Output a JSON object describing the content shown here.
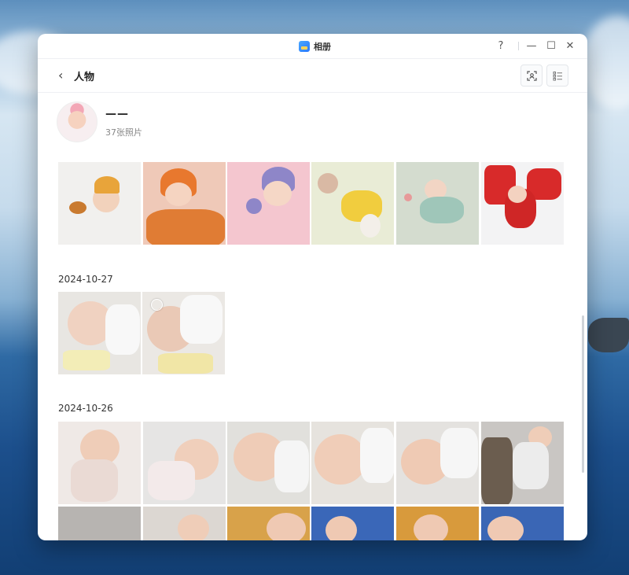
{
  "window": {
    "app_title": "相册",
    "help": "?",
    "minimize": "—",
    "maximize": "☐",
    "close": "✕"
  },
  "header": {
    "back": "‹",
    "title": "人物"
  },
  "person": {
    "name": "——",
    "count": "37张照片"
  },
  "sections": [
    {
      "date": ""
    },
    {
      "date": "2024-10-27"
    },
    {
      "date": "2024-10-26"
    }
  ],
  "icons": {
    "face_scan": "face-scan-icon",
    "list_view": "list-view-icon",
    "app": "album-app-icon"
  },
  "colors": {
    "accent": "#2978ff",
    "window_bg": "#ffffff"
  }
}
